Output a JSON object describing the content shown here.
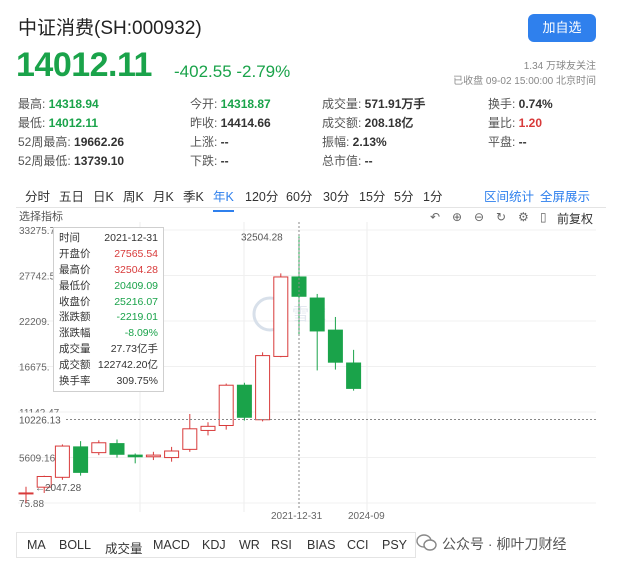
{
  "header": {
    "title": "中证消费(SH:000932)",
    "add_button": "加自选",
    "price": "14012.11",
    "change": "-402.55 -2.79%",
    "followers": "1.34 万球友关注",
    "status": "已收盘 09-02 15:00:00 北京时间"
  },
  "stats": [
    {
      "label": "最高:",
      "value": "14318.94",
      "color": "green"
    },
    {
      "label": "今开:",
      "value": "14318.87",
      "color": "green"
    },
    {
      "label": "成交量:",
      "value": "571.91万手",
      "color": "normal"
    },
    {
      "label": "换手:",
      "value": "0.74%",
      "color": "normal"
    },
    {
      "label": "最低:",
      "value": "14012.11",
      "color": "green"
    },
    {
      "label": "昨收:",
      "value": "14414.66",
      "color": "normal"
    },
    {
      "label": "成交额:",
      "value": "208.18亿",
      "color": "normal"
    },
    {
      "label": "量比:",
      "value": "1.20",
      "color": "red"
    },
    {
      "label": "52周最高:",
      "value": "19662.26",
      "color": "normal"
    },
    {
      "label": "上涨:",
      "value": "--",
      "color": "normal"
    },
    {
      "label": "振幅:",
      "value": "2.13%",
      "color": "normal"
    },
    {
      "label": "平盘:",
      "value": "--",
      "color": "normal"
    },
    {
      "label": "52周最低:",
      "value": "13739.10",
      "color": "normal"
    },
    {
      "label": "下跌:",
      "value": "--",
      "color": "normal"
    },
    {
      "label": "总市值:",
      "value": "--",
      "color": "normal"
    }
  ],
  "period_tabs": [
    "分时",
    "五日",
    "日K",
    "周K",
    "月K",
    "季K",
    "年K",
    "120分",
    "60分",
    "30分",
    "15分",
    "5分",
    "1分"
  ],
  "active_tab": "年K",
  "right_links": [
    "区间统计",
    "全屏展示"
  ],
  "indicator_label": "选择指标",
  "toolbar": {
    "adjust": "前复权"
  },
  "tooltip": [
    {
      "k": "时间",
      "v": "2021-12-31",
      "color": "normal"
    },
    {
      "k": "开盘价",
      "v": "27565.54",
      "color": "red"
    },
    {
      "k": "最高价",
      "v": "32504.28",
      "color": "red"
    },
    {
      "k": "最低价",
      "v": "20409.09",
      "color": "green"
    },
    {
      "k": "收盘价",
      "v": "25216.07",
      "color": "green"
    },
    {
      "k": "涨跌额",
      "v": "-2219.01",
      "color": "green"
    },
    {
      "k": "涨跌幅",
      "v": "-8.09%",
      "color": "green"
    },
    {
      "k": "成交量",
      "v": "27.73亿手",
      "color": "normal"
    },
    {
      "k": "成交额",
      "v": "122742.20亿",
      "color": "normal"
    },
    {
      "k": "换手率",
      "v": "309.75%",
      "color": "normal"
    }
  ],
  "bottom_tabs": [
    "MA",
    "BOLL",
    "成交量",
    "MACD",
    "KDJ",
    "WR",
    "RSI",
    "BIAS",
    "CCI",
    "PSY"
  ],
  "watermark": "公众号 · 柳叶刀财经",
  "colors": {
    "up": "#d83a3a",
    "down": "#1aa34a",
    "accent": "#2f80ed"
  },
  "chart_data": {
    "type": "candlestick",
    "y_tick_labels": [
      "33275.7",
      "27742.5",
      "22209.",
      "16675.",
      "11142.47",
      "5609.16",
      "75.88"
    ],
    "y_ticks": [
      33275.7,
      27742.5,
      22209.2,
      16675.9,
      11142.47,
      5609.16,
      75.88
    ],
    "ylim": [
      75.88,
      33275.7
    ],
    "crosshair_value": "10226.13",
    "crosshair_y": 10226.13,
    "max_label": "32504.28",
    "min_label": "2047.28",
    "x_labels": [
      "2021-12-31",
      "2024-09"
    ],
    "candles": [
      {
        "o": 1200,
        "h": 2047.28,
        "l": 75.88,
        "c": 1300
      },
      {
        "o": 2000,
        "h": 3400,
        "l": 1300,
        "c": 3300
      },
      {
        "o": 3200,
        "h": 7200,
        "l": 2900,
        "c": 7000
      },
      {
        "o": 6900,
        "h": 7600,
        "l": 3400,
        "c": 3800
      },
      {
        "o": 6200,
        "h": 7700,
        "l": 5900,
        "c": 7400
      },
      {
        "o": 7300,
        "h": 7800,
        "l": 5600,
        "c": 6000
      },
      {
        "o": 5900,
        "h": 6100,
        "l": 4900,
        "c": 5700
      },
      {
        "o": 5700,
        "h": 6300,
        "l": 5300,
        "c": 5900
      },
      {
        "o": 5600,
        "h": 6900,
        "l": 5100,
        "c": 6400
      },
      {
        "o": 6600,
        "h": 10900,
        "l": 6300,
        "c": 9100
      },
      {
        "o": 8900,
        "h": 9900,
        "l": 8300,
        "c": 9400
      },
      {
        "o": 9500,
        "h": 14600,
        "l": 9000,
        "c": 14400
      },
      {
        "o": 14400,
        "h": 14700,
        "l": 10100,
        "c": 10500
      },
      {
        "o": 10200,
        "h": 18400,
        "l": 10000,
        "c": 18000
      },
      {
        "o": 17900,
        "h": 28000,
        "l": 17800,
        "c": 27565.54
      },
      {
        "o": 27565.54,
        "h": 32504.28,
        "l": 20409.09,
        "c": 25216.07
      },
      {
        "o": 25000,
        "h": 25500,
        "l": 16200,
        "c": 21000
      },
      {
        "o": 21100,
        "h": 22700,
        "l": 16300,
        "c": 17200
      },
      {
        "o": 17100,
        "h": 18700,
        "l": 13739.1,
        "c": 14012.11
      }
    ]
  }
}
